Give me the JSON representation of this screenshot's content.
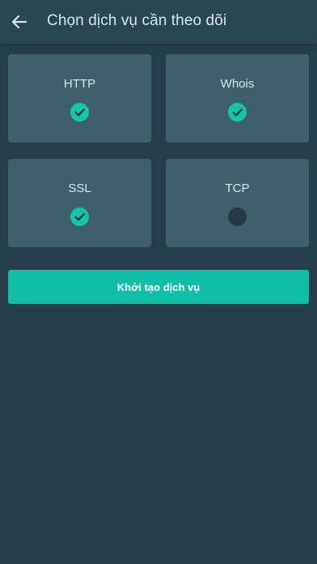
{
  "header": {
    "title": "Chọn dịch vụ cần theo dõi",
    "back_icon": "arrow-left-icon"
  },
  "services": [
    {
      "label": "HTTP",
      "selected": true
    },
    {
      "label": "Whois",
      "selected": true
    },
    {
      "label": "SSL",
      "selected": true
    },
    {
      "label": "TCP",
      "selected": false
    }
  ],
  "actions": {
    "create_label": "Khởi tạo dịch vụ"
  },
  "colors": {
    "background": "#253f4a",
    "header": "#2a4651",
    "card": "#3e5f6b",
    "accent": "#14c6a8",
    "button": "#0fbfa5",
    "unchecked": "#243b45"
  }
}
